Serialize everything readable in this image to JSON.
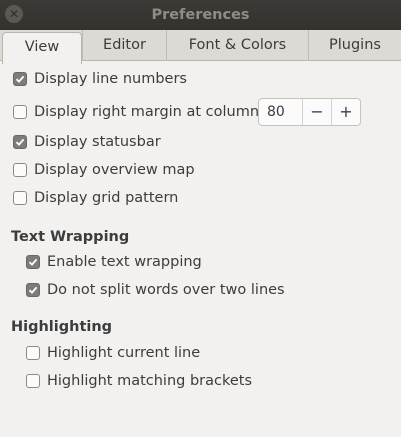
{
  "window": {
    "title": "Preferences"
  },
  "tabs": [
    {
      "label": "View",
      "active": true
    },
    {
      "label": "Editor",
      "active": false
    },
    {
      "label": "Font & Colors",
      "active": false
    },
    {
      "label": "Plugins",
      "active": false
    }
  ],
  "view": {
    "display_line_numbers": {
      "label": "Display line numbers",
      "checked": true
    },
    "display_right_margin": {
      "label": "Display right margin at column:",
      "checked": false
    },
    "right_margin_column": {
      "value": "80",
      "decrement": "−",
      "increment": "+"
    },
    "display_statusbar": {
      "label": "Display statusbar",
      "checked": true
    },
    "display_overview_map": {
      "label": "Display overview map",
      "checked": false
    },
    "display_grid_pattern": {
      "label": "Display grid pattern",
      "checked": false
    }
  },
  "text_wrapping": {
    "heading": "Text Wrapping",
    "enable_text_wrapping": {
      "label": "Enable text wrapping",
      "checked": true
    },
    "no_split_words": {
      "label": "Do not split words over two lines",
      "checked": true
    }
  },
  "highlighting": {
    "heading": "Highlighting",
    "highlight_current_line": {
      "label": "Highlight current line",
      "checked": false
    },
    "highlight_matching_brackets": {
      "label": "Highlight matching brackets",
      "checked": false
    }
  },
  "colors": {
    "titlebar": "#3b3a36",
    "window_bg": "#f2f1f0",
    "checkbox_checked": "#7e7c78"
  },
  "icons": {
    "close": "close-icon",
    "check": "check-icon"
  }
}
